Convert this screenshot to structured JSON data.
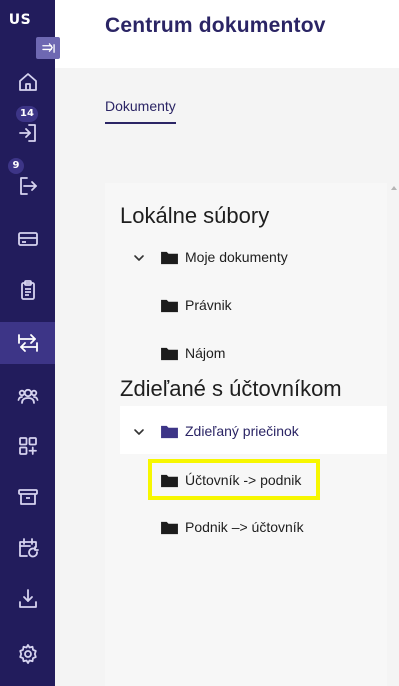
{
  "sidebar": {
    "brand": "US",
    "collapse_icon": "collapse-arrow-icon",
    "items": [
      {
        "name": "home",
        "icon": "home-icon"
      },
      {
        "name": "incoming",
        "icon": "inbox-arrow-icon",
        "badge": "14"
      },
      {
        "name": "outgoing",
        "icon": "outbox-arrow-icon",
        "badge": "9"
      },
      {
        "name": "payments",
        "icon": "credit-card-icon"
      },
      {
        "name": "tasks",
        "icon": "clipboard-icon"
      },
      {
        "name": "documents",
        "icon": "transfer-icon",
        "active": true
      },
      {
        "name": "contacts",
        "icon": "people-icon"
      },
      {
        "name": "apps",
        "icon": "grid-plus-icon"
      },
      {
        "name": "archive",
        "icon": "archive-box-icon"
      },
      {
        "name": "calendar",
        "icon": "calendar-refresh-icon"
      },
      {
        "name": "download",
        "icon": "download-icon"
      },
      {
        "name": "settings",
        "icon": "gear-icon"
      }
    ]
  },
  "header": {
    "title": "Centrum dokumentov"
  },
  "tabs": {
    "active_label": "Dokumenty"
  },
  "tree": {
    "local_title": "Lokálne súbory",
    "local_items": [
      "Moje dokumenty",
      "Právnik",
      "Nájom"
    ],
    "shared_title": "Zdieľané s účtovníkom",
    "shared_root": "Zdieľaný priečinok",
    "shared_items": [
      "Účtovník -> podnik",
      "Podnik –> účtovník"
    ]
  },
  "colors": {
    "sidebar_bg": "#221c5c",
    "accent": "#2b2565",
    "highlight": "#f7f700",
    "selected_folder": "#3d3587"
  }
}
